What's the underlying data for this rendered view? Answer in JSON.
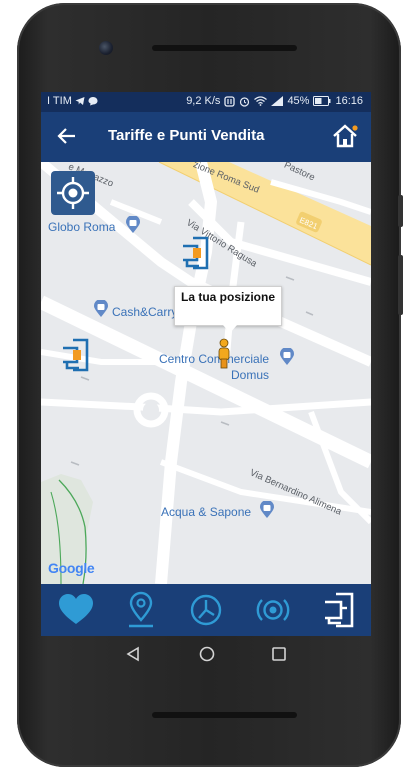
{
  "status_bar": {
    "carrier": "I TIM",
    "speed": "9,2 K/s",
    "battery": "45%",
    "time": "16:16"
  },
  "app_bar": {
    "title": "Tariffe e Punti Vendita",
    "back_icon": "arrow-left-icon",
    "home_icon": "home-icon"
  },
  "map": {
    "labels": {
      "globo_roma": "Globo Roma",
      "cash_carry": "Cash&Carry",
      "centro_commerciale_1": "Centro Commerciale",
      "centro_commerciale_2": "Domus",
      "acqua_sapone": "Acqua & Sapone",
      "via_marrazzo": "e Marrazzo",
      "viale_roma_sud": "zione Roma Sud",
      "via_pastore": "Pastore",
      "via_vittorio_ragusa": "Via Vittorio Ragusa",
      "via_bernardino": "Via Bernardino Alimena",
      "e821": "E821"
    },
    "popup_text": "La tua posizione",
    "watermark": "Google",
    "colors": {
      "road": "#ffffff",
      "highway": "#fbe29a",
      "poi_blue": "#3a72b8",
      "park": "#4ca85a"
    }
  },
  "bottom_nav": {
    "items": [
      {
        "icon": "heart-icon",
        "active": false
      },
      {
        "icon": "map-pin-icon",
        "active": false
      },
      {
        "icon": "clock-icon",
        "active": false
      },
      {
        "icon": "signal-icon",
        "active": false
      },
      {
        "icon": "store-icon",
        "active": true
      }
    ],
    "colors": {
      "active": "#ffffff",
      "inactive": "#2f9bd5"
    }
  },
  "system_nav": {
    "back": "triangle-back-icon",
    "home": "circle-home-icon",
    "recents": "square-recents-icon"
  }
}
